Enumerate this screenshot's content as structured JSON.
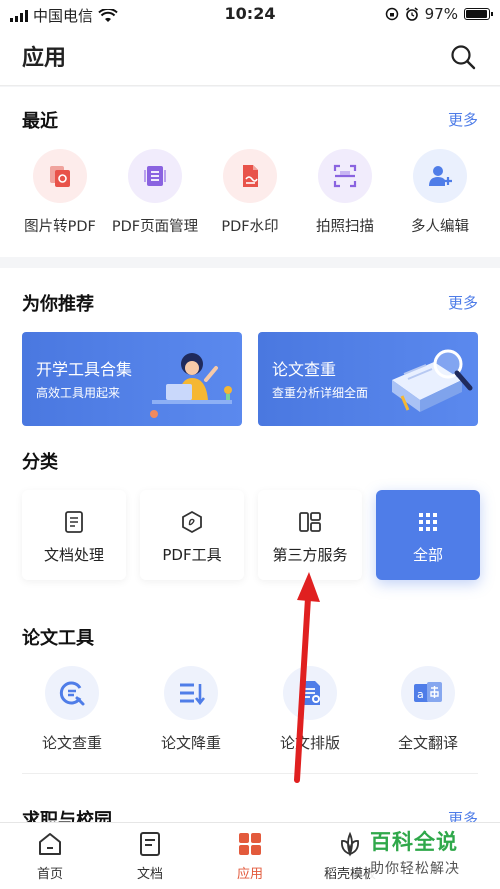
{
  "status_bar": {
    "carrier": "中国电信",
    "time": "10:24",
    "battery": "97%",
    "battery_fraction": 0.97
  },
  "header": {
    "title": "应用"
  },
  "recent": {
    "title": "最近",
    "more": "更多",
    "items": [
      {
        "label": "图片转PDF",
        "icon": "image-to-pdf-icon",
        "color": "#e8534a",
        "bg": "#fdeceb"
      },
      {
        "label": "PDF页面管理",
        "icon": "page-manage-icon",
        "color": "#8a63e0",
        "bg": "#f1ecfc"
      },
      {
        "label": "PDF水印",
        "icon": "watermark-icon",
        "color": "#e8534a",
        "bg": "#fdeceb"
      },
      {
        "label": "拍照扫描",
        "icon": "scan-icon",
        "color": "#8a63e0",
        "bg": "#f1ecfc"
      },
      {
        "label": "多人编辑",
        "icon": "multi-user-edit-icon",
        "color": "#4f7de8",
        "bg": "#eaf0fd"
      }
    ]
  },
  "recommend": {
    "title": "为你推荐",
    "more": "更多",
    "banners": [
      {
        "title": "开学工具合集",
        "subtitle": "高效工具用起来"
      },
      {
        "title": "论文查重",
        "subtitle": "查重分析详细全面"
      }
    ]
  },
  "category": {
    "title": "分类",
    "items": [
      {
        "label": "文档处理",
        "icon": "document-icon"
      },
      {
        "label": "PDF工具",
        "icon": "pdf-tool-icon"
      },
      {
        "label": "第三方服务",
        "icon": "third-party-icon"
      },
      {
        "label": "全部",
        "icon": "grid-icon"
      }
    ]
  },
  "paper_tools": {
    "title": "论文工具",
    "items": [
      {
        "label": "论文查重",
        "icon": "plagiarism-check-icon"
      },
      {
        "label": "论文降重",
        "icon": "rewrite-icon"
      },
      {
        "label": "论文排版",
        "icon": "typeset-icon"
      },
      {
        "label": "全文翻译",
        "icon": "translate-icon"
      }
    ]
  },
  "next_section": {
    "title": "求职与校园",
    "more": "更多"
  },
  "tabbar": {
    "items": [
      {
        "label": "首页",
        "icon": "home-icon"
      },
      {
        "label": "文档",
        "icon": "document-tab-icon"
      },
      {
        "label": "应用",
        "icon": "apps-icon"
      },
      {
        "label": "稻壳模板",
        "icon": "template-leaf-icon"
      }
    ]
  },
  "watermark": {
    "line1": "百科全说",
    "line2": "助你轻松解决"
  },
  "colors": {
    "accent": "#4f7de8",
    "active_tab": "#e35a3c",
    "annotation_arrow": "#e02020"
  }
}
